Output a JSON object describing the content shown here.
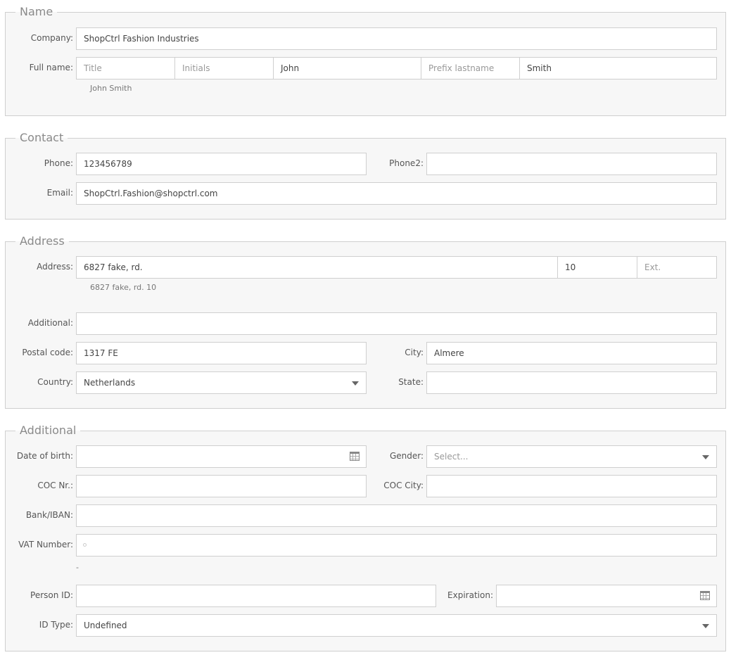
{
  "name_section": {
    "legend": "Name",
    "company_label": "Company:",
    "company_value": "ShopCtrl Fashion Industries",
    "fullname_label": "Full name:",
    "title_placeholder": "Title",
    "initials_placeholder": "Initials",
    "firstname_value": "John",
    "prefix_placeholder": "Prefix lastname",
    "lastname_value": "Smith",
    "fullname_hint": "John Smith"
  },
  "contact_section": {
    "legend": "Contact",
    "phone_label": "Phone:",
    "phone_value": "123456789",
    "phone2_label": "Phone2:",
    "phone2_value": "",
    "email_label": "Email:",
    "email_value": "ShopCtrl.Fashion@shopctrl.com"
  },
  "address_section": {
    "legend": "Address",
    "address_label": "Address:",
    "street_value": "6827 fake, rd.",
    "number_value": "10",
    "ext_placeholder": "Ext.",
    "address_hint": "6827 fake, rd. 10",
    "additional_label": "Additional:",
    "additional_value": "",
    "postal_label": "Postal code:",
    "postal_value": "1317 FE",
    "city_label": "City:",
    "city_value": "Almere",
    "country_label": "Country:",
    "country_value": "Netherlands",
    "state_label": "State:",
    "state_value": ""
  },
  "additional_section": {
    "legend": "Additional",
    "dob_label": "Date of birth:",
    "dob_value": "",
    "gender_label": "Gender:",
    "gender_placeholder": "Select...",
    "coc_label": "COC Nr.:",
    "coc_value": "",
    "coc_city_label": "COC City:",
    "coc_city_value": "",
    "bank_label": "Bank/IBAN:",
    "bank_value": "",
    "vat_label": "VAT Number:",
    "vat_value": "",
    "vat_hint": "-",
    "person_id_label": "Person ID:",
    "person_id_value": "",
    "expiration_label": "Expiration:",
    "expiration_value": "",
    "id_type_label": "ID Type:",
    "id_type_value": "Undefined"
  },
  "icons": {
    "dropdown": "chevron-down-icon",
    "calendar": "calendar-icon",
    "vat_status": "status-dot-icon"
  }
}
